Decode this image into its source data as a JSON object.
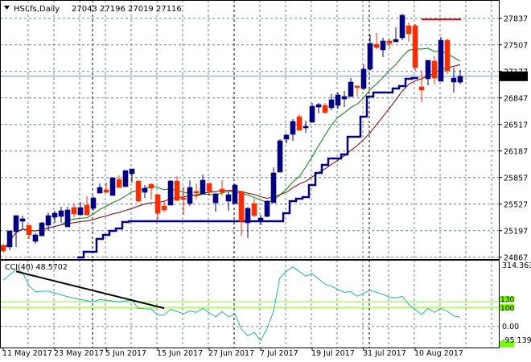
{
  "chart_data": {
    "type": "candlestick",
    "title": "HSI,fs,Daily",
    "ohlc_readout": [
      "27043",
      "27196",
      "27019",
      "27116"
    ],
    "colors": {
      "bull": "#000080",
      "bear": "#ff2a00",
      "ma_fast": "#008000",
      "ma_slow": "#800000",
      "channel": "#000080",
      "cci": "#20b2aa",
      "level": "#7cfc00",
      "resistance": "#ff0000",
      "trendline": "#000000"
    },
    "price_axis": {
      "ticks": [
        "27837",
        "27507",
        "27177",
        "26847",
        "26517",
        "26187",
        "25857",
        "25527",
        "25197",
        "24867"
      ],
      "current_price": "27116",
      "range": [
        24860,
        28064
      ]
    },
    "x_labels": [
      "11 May 2017",
      "23 May 2017",
      "5 Jun 2017",
      "15 Jun 2017",
      "27 Jun 2017",
      "7 Jul 2017",
      "19 Jul 2017",
      "31 Jul 2017",
      "10 Aug 2017"
    ],
    "x_label_bar_step": 8,
    "candles": [
      [
        25014,
        25034,
        24924,
        24944
      ],
      [
        24994,
        25194,
        24954,
        25194
      ],
      [
        25184,
        25384,
        24994,
        25384
      ],
      [
        25314,
        25384,
        25204,
        25344
      ],
      [
        25264,
        25264,
        25094,
        25144
      ],
      [
        25064,
        25164,
        25034,
        25144
      ],
      [
        25134,
        25304,
        25124,
        25294
      ],
      [
        25264,
        25424,
        25194,
        25384
      ],
      [
        25364,
        25444,
        25294,
        25414
      ],
      [
        25374,
        25494,
        25294,
        25444
      ],
      [
        25244,
        25494,
        25244,
        25454
      ],
      [
        25484,
        25534,
        25364,
        25404
      ],
      [
        25394,
        25554,
        25384,
        25484
      ],
      [
        25514,
        25624,
        25384,
        25394
      ],
      [
        25474,
        25624,
        25444,
        25604
      ],
      [
        25664,
        25784,
        25664,
        25734
      ],
      [
        25704,
        25794,
        25664,
        25674
      ],
      [
        25634,
        25854,
        25634,
        25854
      ],
      [
        25834,
        25884,
        25734,
        25734
      ],
      [
        25744,
        25944,
        25744,
        25944
      ],
      [
        25904,
        25964,
        25794,
        25964
      ],
      [
        25814,
        25824,
        25544,
        25564
      ],
      [
        25674,
        25764,
        25604,
        25724
      ],
      [
        25774,
        25784,
        25584,
        25724
      ],
      [
        25644,
        25644,
        25334,
        25414
      ],
      [
        25504,
        25574,
        25424,
        25454
      ],
      [
        25514,
        25824,
        25514,
        25814
      ],
      [
        25814,
        25874,
        25564,
        25574
      ],
      [
        25604,
        25744,
        25394,
        25584
      ],
      [
        25534,
        25824,
        25504,
        25734
      ],
      [
        25684,
        25784,
        25584,
        25664
      ],
      [
        25654,
        25894,
        25654,
        25824
      ],
      [
        25784,
        25794,
        25624,
        25684
      ],
      [
        25544,
        25664,
        25434,
        25654
      ],
      [
        25714,
        25824,
        25634,
        25674
      ],
      [
        25564,
        25674,
        25444,
        25644
      ],
      [
        25534,
        25774,
        25534,
        25764
      ],
      [
        25684,
        25694,
        25134,
        25314
      ],
      [
        25294,
        25494,
        25104,
        25474
      ],
      [
        25534,
        25594,
        25364,
        25384
      ],
      [
        25314,
        25394,
        25264,
        25354
      ],
      [
        25374,
        25574,
        25364,
        25564
      ],
      [
        25544,
        25984,
        25544,
        25914
      ],
      [
        25924,
        26334,
        25924,
        26314
      ],
      [
        26334,
        26404,
        26284,
        26384
      ],
      [
        26394,
        26584,
        26314,
        26554
      ],
      [
        26614,
        26644,
        26444,
        26444
      ],
      [
        26474,
        26564,
        26414,
        26494
      ],
      [
        26544,
        26784,
        26544,
        26744
      ],
      [
        26734,
        26784,
        26654,
        26764
      ],
      [
        26754,
        26784,
        26654,
        26664
      ],
      [
        26724,
        26894,
        26694,
        26824
      ],
      [
        26754,
        26914,
        26714,
        26884
      ],
      [
        26834,
        26934,
        26734,
        26864
      ],
      [
        26864,
        27094,
        26864,
        27044
      ],
      [
        26994,
        27004,
        26864,
        26974
      ],
      [
        26964,
        27264,
        26944,
        27204
      ],
      [
        27204,
        27634,
        27184,
        27524
      ],
      [
        27514,
        27654,
        27454,
        27474
      ],
      [
        27444,
        27594,
        27354,
        27554
      ],
      [
        27554,
        27584,
        27464,
        27524
      ],
      [
        27544,
        27724,
        27544,
        27574
      ],
      [
        27594,
        27894,
        27564,
        27874
      ],
      [
        27744,
        27784,
        27544,
        27644
      ],
      [
        27744,
        27764,
        27184,
        27224
      ],
      [
        26984,
        27184,
        26794,
        26944
      ],
      [
        27084,
        27314,
        27004,
        27314
      ],
      [
        27304,
        27374,
        27014,
        27094
      ],
      [
        27054,
        27604,
        27054,
        27564
      ],
      [
        27564,
        27584,
        27144,
        27184
      ],
      [
        27044,
        27224,
        26914,
        27094
      ],
      [
        27043,
        27196,
        27019,
        27116
      ]
    ],
    "ma_fast_period": 10,
    "ma_slow_period": 21,
    "channel_line": [
      null,
      null,
      null,
      null,
      null,
      null,
      null,
      null,
      null,
      null,
      null,
      null,
      24864,
      24934,
      24934,
      25094,
      25144,
      25194,
      25224,
      25304,
      25314,
      25314,
      25314,
      25314,
      25314,
      25314,
      25314,
      25314,
      25314,
      25314,
      25314,
      25314,
      25314,
      25314,
      25314,
      25314,
      25314,
      25314,
      25314,
      25314,
      25314,
      25314,
      25314,
      25314,
      25414,
      25564,
      25594,
      25614,
      25764,
      25914,
      26014,
      26094,
      26094,
      26144,
      26364,
      26364,
      26614,
      26864,
      26914,
      26914,
      26914,
      26964,
      26994,
      27084,
      27094
    ],
    "resistance_line": {
      "price": 27824,
      "from_bar": 65,
      "to_bar": 71
    },
    "cci": {
      "label": "CCI(40) 48.5702",
      "range": [
        -95.1391,
        314.3633
      ],
      "levels": [
        "130",
        "100"
      ],
      "axis_labels": [
        "314.3633",
        "0.00",
        "-95.1391"
      ],
      "level_values": [
        130,
        100
      ],
      "values": [
        244,
        272,
        300,
        286,
        215,
        183,
        185,
        187,
        176,
        166,
        157,
        149,
        142,
        135,
        130,
        142,
        138,
        134,
        130,
        134,
        138,
        95,
        93,
        92,
        60,
        60,
        91,
        79,
        67,
        81,
        74,
        95,
        72,
        50,
        78,
        50,
        64,
        -14,
        -49,
        -32,
        -75,
        -11,
        81,
        258,
        290,
        315,
        290,
        265,
        279,
        250,
        223,
        212,
        195,
        180,
        183,
        159,
        175,
        191,
        180,
        168,
        155,
        150,
        159,
        116,
        90,
        62,
        95,
        74,
        95,
        80,
        55,
        48.57
      ],
      "trendline": {
        "from_bar": 2,
        "from_value": 290,
        "to_bar": 25,
        "to_value": 96
      }
    }
  }
}
